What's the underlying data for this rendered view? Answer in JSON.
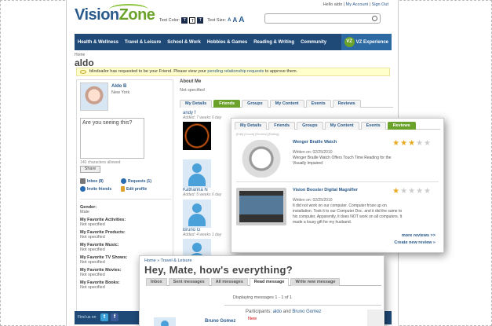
{
  "header": {
    "logo_vision": "Vision",
    "logo_zone": "Zone",
    "user_greeting": "Hello aldo",
    "my_account": "My Account",
    "sign_out": "Sign Out",
    "text_color_label": "Text Color:",
    "text_color_opts": [
      "T",
      "T",
      "T"
    ],
    "text_size_label": "Text Size:",
    "text_size_opts": [
      "A",
      "A",
      "A"
    ]
  },
  "nav": {
    "items": [
      "Health & Wellness",
      "Travel & Leisure",
      "School & Work",
      "Hobbies & Games",
      "Reading & Writing",
      "Community"
    ],
    "vz_badge": "VZ",
    "vz_experience": "VZ Experience"
  },
  "breadcrumb": "Home",
  "username": "aldo",
  "notice": {
    "text": "blindsailor has requested to be your Friend. Please view your ",
    "link": "pending relationship requests",
    "suffix": " to approve them."
  },
  "profile": {
    "name": "Aldo B",
    "location": "New York",
    "status_text": "Are you seeing this?",
    "char_count": "140 characters allowed",
    "share": "Share",
    "inbox": "Inbox (8)",
    "requests": "Requests (1)",
    "invite": "Invite friends",
    "edit": "Edit profile",
    "facts": [
      {
        "label": "Gender:",
        "value": "Male"
      },
      {
        "label": "My Favorite Activities:",
        "value": "Not specified"
      },
      {
        "label": "My Favorite Products:",
        "value": "Not specified"
      },
      {
        "label": "My Favorite Music:",
        "value": "Not specified"
      },
      {
        "label": "My Favorite TV Shows:",
        "value": "Not specified"
      },
      {
        "label": "My Favorite Movies:",
        "value": "Not specified"
      },
      {
        "label": "My Favorite Books:",
        "value": "Not specified"
      }
    ]
  },
  "about": {
    "title": "About Me",
    "value": "Not specified"
  },
  "tabs": [
    "My Details",
    "Friends",
    "Groups",
    "My Content",
    "Events",
    "Reviews"
  ],
  "friends": [
    {
      "name": "andy f",
      "added": "Added: 7 weeks 6 day"
    },
    {
      "name": "Katharina N",
      "added": "Added: 5 weeks 6 day"
    },
    {
      "name": "Bruno G",
      "added": "Added: 4 weeks 1 day"
    }
  ],
  "reviews_popup": {
    "tabs": [
      "My Details",
      "Friends",
      "Groups",
      "My Content",
      "Events",
      "Reviews"
    ],
    "meta": "[Edit] [Count] [Review] [Rating]",
    "reviews": [
      {
        "title": "Wenger Braille Watch",
        "date": "Written on: 02/25/2010",
        "text": "Wenger Braille Watch Offers Touch Time Reading for the Visually Impaired",
        "rating": 3
      },
      {
        "title": "Vision Booster Digital Magnifier",
        "date": "Written on: 02/25/2010",
        "text": "It did not work on our computer. Computer froze up on installation. Took it to our Computer Doc. and it did the same to his computer. Apparently, it does NOT work on all computers. It made a lousy gift for my husband.",
        "rating": 1
      }
    ],
    "more_reviews": "more reviews >>",
    "create_review": "Create new review »"
  },
  "messages_popup": {
    "breadcrumb": "Home » Travel & Leisure",
    "title": "Hey, Mate, how's everything?",
    "tabs": [
      "Inbox",
      "Sent messages",
      "All messages",
      "Read message",
      "Write new message"
    ],
    "displaying": "Displaying messages 1 - 1 of 1",
    "participants_label": "Participants: ",
    "participant_a": "aldo",
    "participants_and": " and ",
    "participant_b": "Bruno Gomez",
    "sender": "Bruno Gomez",
    "new_label": "New"
  },
  "footer": {
    "find_us": "Find us on",
    "twitter": "t",
    "facebook": "f"
  }
}
